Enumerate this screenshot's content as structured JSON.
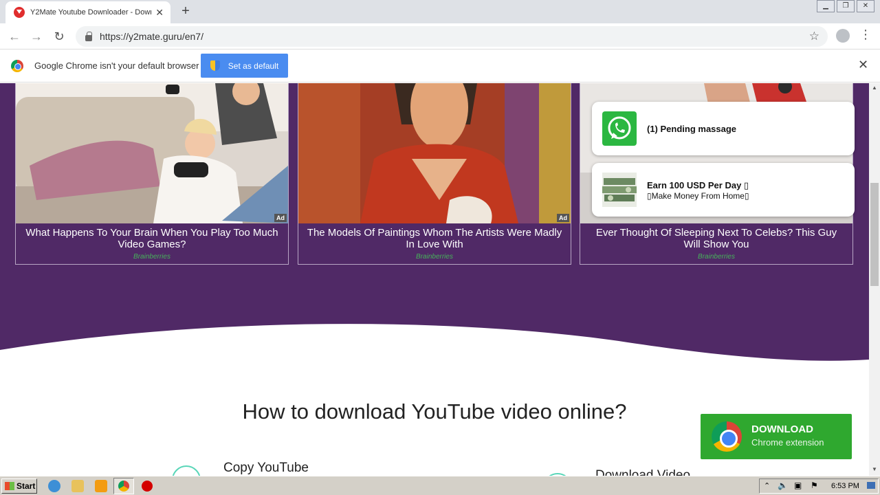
{
  "browser": {
    "tab_title": "Y2Mate Youtube Downloader - Download",
    "url": "https://y2mate.guru/en7/"
  },
  "infobar": {
    "message": "Google Chrome isn't your default browser",
    "button_label": "Set as default"
  },
  "ad_cards": [
    {
      "title": "What Happens To Your Brain When You Play Too Much Video Games?",
      "source": "Brainberries",
      "badge": "Ad"
    },
    {
      "title": "The Models Of Paintings Whom The Artists Were Madly In Love With",
      "source": "Brainberries",
      "badge": "Ad"
    },
    {
      "title": "Ever Thought Of Sleeping Next To Celebs? This Guy Will Show You",
      "source": "Brainberries",
      "badge": ""
    }
  ],
  "notifications": [
    {
      "title": "(1) Pending massage",
      "subtitle": ""
    },
    {
      "title": "Earn 100 USD Per Day ▯",
      "subtitle": "▯Make Money From Home▯"
    }
  ],
  "how_to": {
    "title": "How to download YouTube video online?",
    "step1": "Copy YouTube",
    "step2": "Download Video"
  },
  "download_button": {
    "title": "DOWNLOAD",
    "subtitle": "Chrome extension"
  },
  "taskbar": {
    "start_label": "Start",
    "clock": "6:53 PM"
  }
}
